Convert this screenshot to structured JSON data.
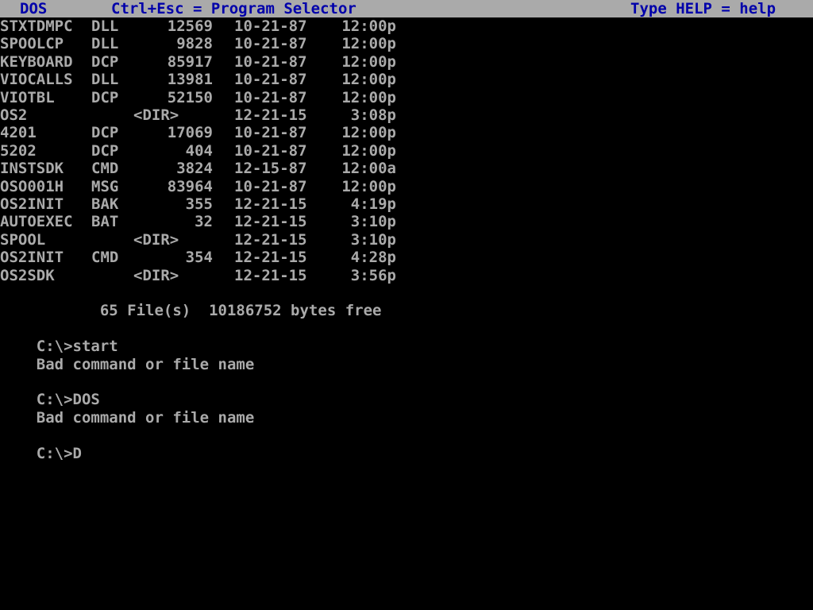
{
  "status_bar": {
    "left": "DOS",
    "center": "Ctrl+Esc = Program Selector",
    "right": "Type HELP = help"
  },
  "directory_listing": [
    {
      "name": "STXTDMPC",
      "ext": "DLL",
      "size": "12569",
      "date": "10-21-87",
      "time": "12:00p"
    },
    {
      "name": "SPOOLCP",
      "ext": "DLL",
      "size": "9828",
      "date": "10-21-87",
      "time": "12:00p"
    },
    {
      "name": "KEYBOARD",
      "ext": "DCP",
      "size": "85917",
      "date": "10-21-87",
      "time": "12:00p"
    },
    {
      "name": "VIOCALLS",
      "ext": "DLL",
      "size": "13981",
      "date": "10-21-87",
      "time": "12:00p"
    },
    {
      "name": "VIOTBL",
      "ext": "DCP",
      "size": "52150",
      "date": "10-21-87",
      "time": "12:00p"
    },
    {
      "name": "OS2",
      "ext": "",
      "size": "<DIR>",
      "date": "12-21-15",
      "time": "3:08p"
    },
    {
      "name": "4201",
      "ext": "DCP",
      "size": "17069",
      "date": "10-21-87",
      "time": "12:00p"
    },
    {
      "name": "5202",
      "ext": "DCP",
      "size": "404",
      "date": "10-21-87",
      "time": "12:00p"
    },
    {
      "name": "INSTSDK",
      "ext": "CMD",
      "size": "3824",
      "date": "12-15-87",
      "time": "12:00a"
    },
    {
      "name": "OSO001H",
      "ext": "MSG",
      "size": "83964",
      "date": "10-21-87",
      "time": "12:00p"
    },
    {
      "name": "OS2INIT",
      "ext": "BAK",
      "size": "355",
      "date": "12-21-15",
      "time": "4:19p"
    },
    {
      "name": "AUTOEXEC",
      "ext": "BAT",
      "size": "32",
      "date": "12-21-15",
      "time": "3:10p"
    },
    {
      "name": "SPOOL",
      "ext": "",
      "size": "<DIR>",
      "date": "12-21-15",
      "time": "3:10p"
    },
    {
      "name": "OS2INIT",
      "ext": "CMD",
      "size": "354",
      "date": "12-21-15",
      "time": "4:28p"
    },
    {
      "name": "OS2SDK",
      "ext": "",
      "size": "<DIR>",
      "date": "12-21-15",
      "time": "3:56p"
    }
  ],
  "summary": "       65 File(s)  10186752 bytes free",
  "session": [
    {
      "prompt": "C:\\>",
      "command": "start",
      "output": "Bad command or file name"
    },
    {
      "prompt": "C:\\>",
      "command": "DOS",
      "output": "Bad command or file name"
    }
  ],
  "current_prompt": "C:\\>",
  "current_input": "D",
  "colors": {
    "background": "#000000",
    "text": "#aaaaaa",
    "status_bar_bg": "#aaaaaa",
    "status_bar_text": "#0000aa"
  }
}
